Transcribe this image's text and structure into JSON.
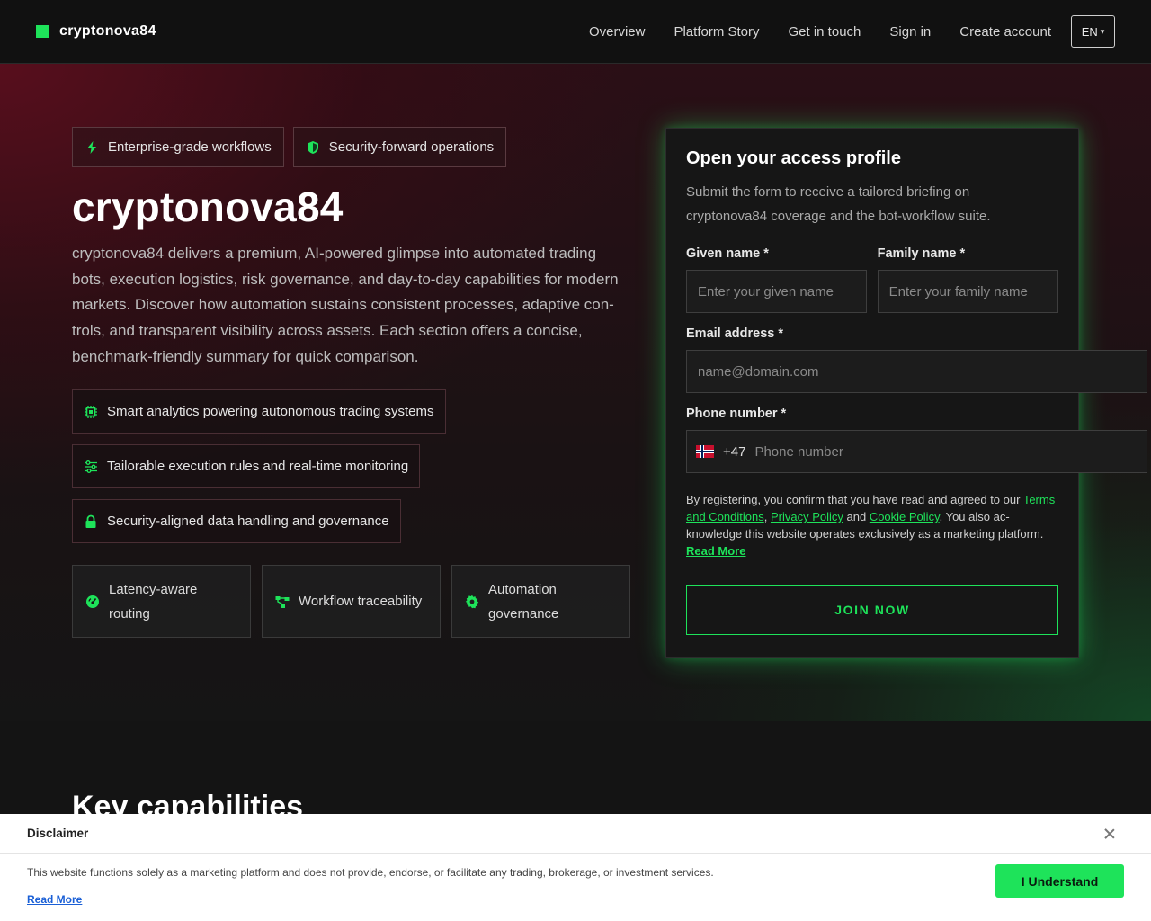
{
  "brand": {
    "name": "cryptonova84"
  },
  "nav": {
    "links": [
      "Overview",
      "Platform Story",
      "Get in touch",
      "Sign in",
      "Create account"
    ],
    "lang": "EN"
  },
  "hero": {
    "badges": [
      "Enterprise-grade workflows",
      "Security-forward operations"
    ],
    "title": "cryptonova84",
    "description": "cryptonova84 delivers a premium, AI-powered glimpse into automated trading bots, execution logistics, risk governance, and day-to-day capabilities for modern markets. Discover how automation sustains consistent processes, adaptive con-trols, and transparent visibility across assets. Each section offers a concise, benchmark-friendly summary for quick comparison.",
    "features": [
      "Smart analytics powering autonomous trading systems",
      "Tailorable execution rules and real-time monitoring",
      "Security-aligned data handling and governance"
    ],
    "cards": [
      "Latency-aware routing",
      "Workflow traceability",
      "Automation governance"
    ]
  },
  "form": {
    "title": "Open your access profile",
    "subtitle": "Submit the form to receive a tailored briefing on cryptonova84 coverage and the bot-workflow suite.",
    "given_label": "Given name *",
    "given_placeholder": "Enter your given name",
    "family_label": "Family name *",
    "family_placeholder": "Enter your family name",
    "email_label": "Email address *",
    "email_placeholder": "name@domain.com",
    "phone_label": "Phone number *",
    "phone_code": "+47",
    "phone_placeholder": "Phone number",
    "legal_prefix": "By registering, you confirm that you have read and agreed to our ",
    "terms": "Terms and Conditions",
    "privacy": "Privacy Policy",
    "and": " and ",
    "cookie": "Cookie Policy",
    "legal_suffix": ". You also ac-knowledge this website operates exclusively as a marketing platform.",
    "read_more": "Read More",
    "submit": "JOIN NOW"
  },
  "section": {
    "key_capabilities": "Key capabilities"
  },
  "disclaimer": {
    "title": "Disclaimer",
    "text": "This website functions solely as a marketing platform and does not provide, endorse, or facilitate any trading, brokerage, or investment services.",
    "read_more": "Read More",
    "button": "I Understand"
  },
  "colors": {
    "accent": "#1ee35a",
    "background": "#141414",
    "hero_red": "#600e1e"
  }
}
